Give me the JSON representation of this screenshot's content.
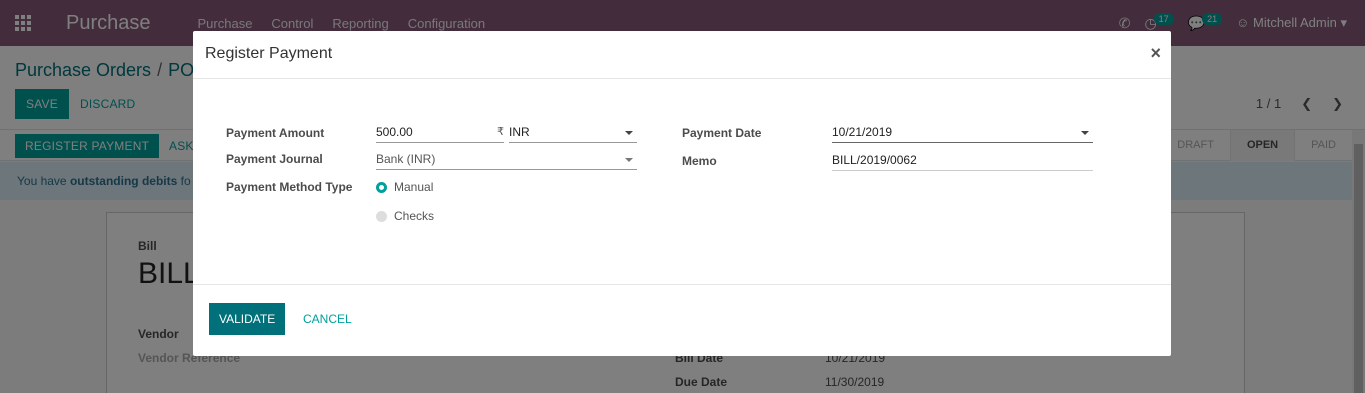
{
  "navbar": {
    "app_title": "Purchase",
    "menu": [
      "Purchase",
      "Control",
      "Reporting",
      "Configuration"
    ],
    "activity_count": "17",
    "message_count": "21",
    "user_name": "Mitchell Admin"
  },
  "control_panel": {
    "breadcrumb_root": "Purchase Orders",
    "breadcrumb_current": "PO",
    "save_label": "SAVE",
    "discard_label": "DISCARD",
    "pager_text": "1 / 1"
  },
  "statusbar": {
    "register_payment_label": "REGISTER PAYMENT",
    "ask_label": "ASK",
    "stages": [
      "DRAFT",
      "OPEN",
      "PAID"
    ],
    "active_stage": "OPEN"
  },
  "alert": {
    "prefix": "You have ",
    "bold": "outstanding debits",
    "suffix": " fo"
  },
  "sheet": {
    "bill_label": "Bill",
    "bill_name": "BILL",
    "vendor_label": "Vendor",
    "vendor_reference_label": "Vendor Reference",
    "bill_date_label": "Bill Date",
    "bill_date_value": "10/21/2019",
    "due_date_label": "Due Date",
    "due_date_value": "11/30/2019"
  },
  "modal": {
    "title": "Register Payment",
    "close_glyph": "×",
    "payment_amount_label": "Payment Amount",
    "payment_amount_value": "500.00",
    "currency_symbol": "₹",
    "currency_value": "INR",
    "payment_journal_label": "Payment Journal",
    "payment_journal_value": "Bank (INR)",
    "payment_method_label": "Payment Method Type",
    "method_manual": "Manual",
    "method_checks": "Checks",
    "payment_date_label": "Payment Date",
    "payment_date_value": "10/21/2019",
    "memo_label": "Memo",
    "memo_value": "BILL/2019/0062",
    "validate_label": "VALIDATE",
    "cancel_label": "CANCEL"
  },
  "colors": {
    "brand": "#875a7b",
    "primary": "#00a09d",
    "primary_dark": "#00707a"
  }
}
